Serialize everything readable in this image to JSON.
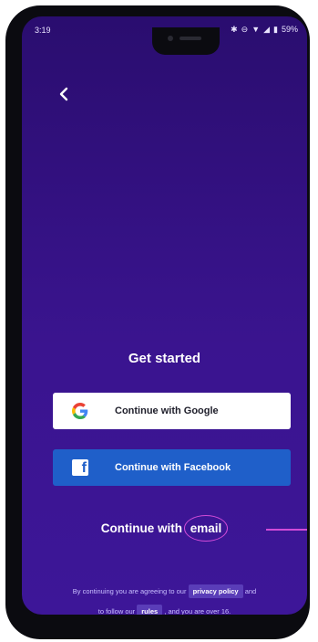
{
  "status_bar": {
    "time": "3:19",
    "battery": "59%"
  },
  "icons": {
    "back": "chevron-left-icon",
    "google": "google-g-icon",
    "facebook": "facebook-f-icon"
  },
  "title": "Get started",
  "buttons": {
    "google_label": "Continue with Google",
    "facebook_label": "Continue with Facebook",
    "email_prefix": "Continue with",
    "email_link": "email"
  },
  "legal": {
    "line1_prefix": "By continuing you are agreeing to our",
    "privacy_link": "privacy policy",
    "line1_suffix": "and",
    "line2_prefix": "to follow our",
    "rules_link": "rules",
    "line2_suffix": ", and you are over 16."
  },
  "colors": {
    "background_top": "#2a0d6f",
    "background_bottom": "#3d1698",
    "facebook_blue": "#1f5fc9",
    "highlight_magenta": "#d14bd8"
  }
}
